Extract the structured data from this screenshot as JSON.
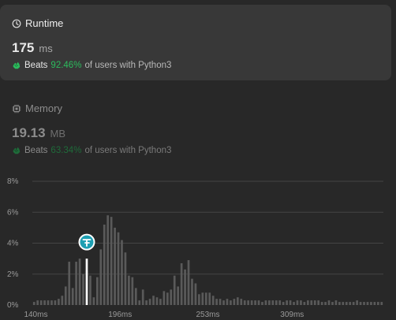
{
  "runtime": {
    "title": "Runtime",
    "value": "175",
    "unit": "ms",
    "beats_label": "Beats",
    "beats_pct": "92.46%",
    "beats_tail": "of users with Python3"
  },
  "memory": {
    "title": "Memory",
    "value": "19.13",
    "unit": "MB",
    "beats_label": "Beats",
    "beats_pct": "63.34%",
    "beats_tail": "of users with Python3"
  },
  "colors": {
    "background": "#282828",
    "card": "#383838",
    "accent_green": "#2cbb5d",
    "bar": "#5a5a5a",
    "marker": "#ffffff"
  },
  "icons": {
    "runtime": "clock-icon",
    "memory": "chip-icon",
    "beats": "clap-icon",
    "marker": "user-avatar-icon"
  },
  "chart_data": {
    "type": "bar",
    "title": "",
    "xlabel": "",
    "ylabel": "",
    "ylim": [
      0,
      8
    ],
    "y_ticks": [
      "0%",
      "2%",
      "4%",
      "6%",
      "8%"
    ],
    "x_tick_labels": [
      {
        "label": "140ms",
        "index": 1
      },
      {
        "label": "196ms",
        "index": 25
      },
      {
        "label": "253ms",
        "index": 50
      },
      {
        "label": "309ms",
        "index": 74
      }
    ],
    "grid": true,
    "values": [
      0.2,
      0.3,
      0.3,
      0.3,
      0.3,
      0.3,
      0.3,
      0.4,
      0.6,
      1.2,
      2.8,
      1.1,
      2.8,
      3.0,
      2.0,
      2.2,
      1.9,
      0.5,
      1.8,
      3.6,
      5.2,
      5.8,
      5.7,
      5.0,
      4.7,
      4.2,
      3.4,
      1.9,
      1.8,
      1.1,
      0.3,
      1.0,
      0.3,
      0.4,
      0.6,
      0.5,
      0.4,
      0.9,
      0.8,
      1.0,
      1.9,
      1.2,
      2.7,
      2.3,
      2.9,
      1.7,
      1.4,
      0.7,
      0.8,
      0.8,
      0.8,
      0.6,
      0.4,
      0.4,
      0.3,
      0.4,
      0.3,
      0.4,
      0.5,
      0.4,
      0.3,
      0.3,
      0.3,
      0.3,
      0.3,
      0.2,
      0.3,
      0.3,
      0.3,
      0.3,
      0.3,
      0.2,
      0.3,
      0.3,
      0.2,
      0.3,
      0.3,
      0.2,
      0.3,
      0.3,
      0.3,
      0.3,
      0.2,
      0.2,
      0.3,
      0.2,
      0.3,
      0.2,
      0.2,
      0.2,
      0.2,
      0.2,
      0.3,
      0.2,
      0.2,
      0.2,
      0.2,
      0.2,
      0.2,
      0.2
    ],
    "highlight_index": 15,
    "highlight_value": 3.0
  }
}
